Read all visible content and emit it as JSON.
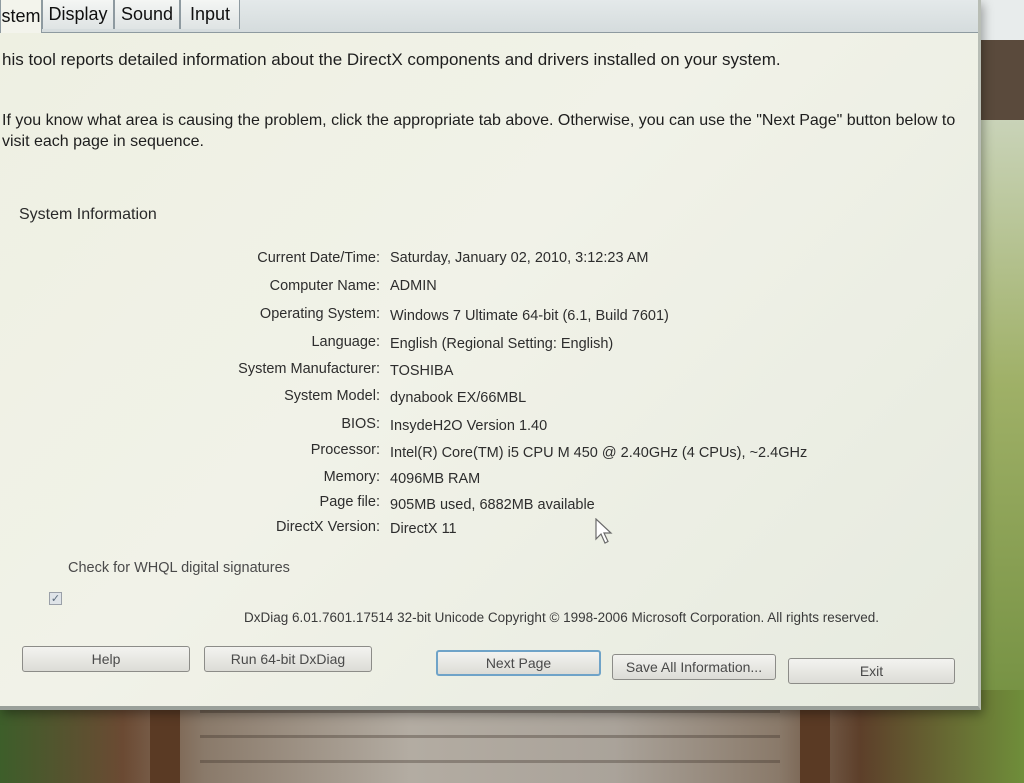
{
  "tabs": [
    {
      "label": "stem",
      "active": true
    },
    {
      "label": "Display",
      "active": false
    },
    {
      "label": "Sound",
      "active": false
    },
    {
      "label": "Input",
      "active": false
    }
  ],
  "intro": {
    "line1": "his tool reports detailed information about the DirectX components and drivers installed on your system.",
    "line2a": "If you know what area is causing the problem, click the appropriate tab above.  Otherwise, you can use the \"Next Page\" button below to",
    "line2b": "visit each page in sequence."
  },
  "system_info": {
    "group_title": "System Information",
    "rows": [
      {
        "label": "Current Date/Time:",
        "value": "Saturday, January 02, 2010, 3:12:23 AM"
      },
      {
        "label": "Computer Name:",
        "value": "ADMIN"
      },
      {
        "label": "Operating System:",
        "value": "Windows 7 Ultimate 64-bit (6.1, Build 7601)"
      },
      {
        "label": "Language:",
        "value": "English (Regional Setting: English)"
      },
      {
        "label": "System Manufacturer:",
        "value": "TOSHIBA"
      },
      {
        "label": "System Model:",
        "value": "dynabook EX/66MBL"
      },
      {
        "label": "BIOS:",
        "value": "InsydeH2O Version 1.40"
      },
      {
        "label": "Processor:",
        "value": "Intel(R) Core(TM) i5 CPU       M 450  @ 2.40GHz (4 CPUs), ~2.4GHz"
      },
      {
        "label": "Memory:",
        "value": "4096MB RAM"
      },
      {
        "label": "Page file:",
        "value": "905MB used, 6882MB available"
      },
      {
        "label": "DirectX Version:",
        "value": "DirectX 11"
      }
    ]
  },
  "whql_checkbox": {
    "label": "Check for WHQL digital signatures",
    "checked": true
  },
  "footer": "DxDiag 6.01.7601.17514 32-bit Unicode  Copyright © 1998-2006 Microsoft Corporation.  All rights reserved.",
  "buttons": {
    "help": "Help",
    "run64": "Run 64-bit DxDiag",
    "next": "Next Page",
    "save": "Save All Information...",
    "exit": "Exit"
  },
  "icons": {
    "cursor": "mouse-pointer-icon",
    "check": "checkmark-icon"
  },
  "colors": {
    "window_bg": "#eef0e2",
    "default_button_border": "#6fa3c8"
  }
}
